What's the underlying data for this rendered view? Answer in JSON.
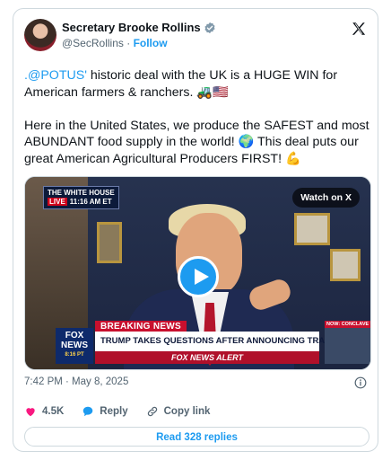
{
  "author": {
    "name": "Secretary Brooke Rollins",
    "handle": "@SecRollins",
    "separator": "·",
    "follow_label": "Follow"
  },
  "tweet": {
    "mention": ".@POTUS'",
    "line1_rest": " historic deal with the UK is a HUGE WIN for American farmers & ranchers. 🚜🇺🇸",
    "paragraph2": "Here in the United States, we produce the SAFEST and most ABUNDANT food supply in the world! 🌍 This deal puts our great American Agricultural Producers FIRST! 💪"
  },
  "media": {
    "watch_label": "Watch on X",
    "wh_live": "LIVE",
    "wh_title": "THE WHITE HOUSE",
    "wh_time": "11:16 AM ET",
    "fox_logo_line1": "FOX",
    "fox_logo_line2": "NEWS",
    "fox_time": "8:16 PT",
    "breaking": "BREAKING NEWS",
    "headline": "TRUMP TAKES QUESTIONS AFTER ANNOUNCING TRADE DEAL",
    "alert": "FOX NEWS ALERT",
    "side_label": "NOW: CONCLAVE UNDERWAY"
  },
  "timestamp": "7:42 PM · May 8, 2025",
  "actions": {
    "like_count": "4.5K",
    "reply_label": "Reply",
    "copy_label": "Copy link"
  },
  "read_replies": "Read 328 replies",
  "colors": {
    "accent": "#1d9bf0",
    "like": "#f91880",
    "border": "#cfd9de",
    "muted": "#536471"
  }
}
